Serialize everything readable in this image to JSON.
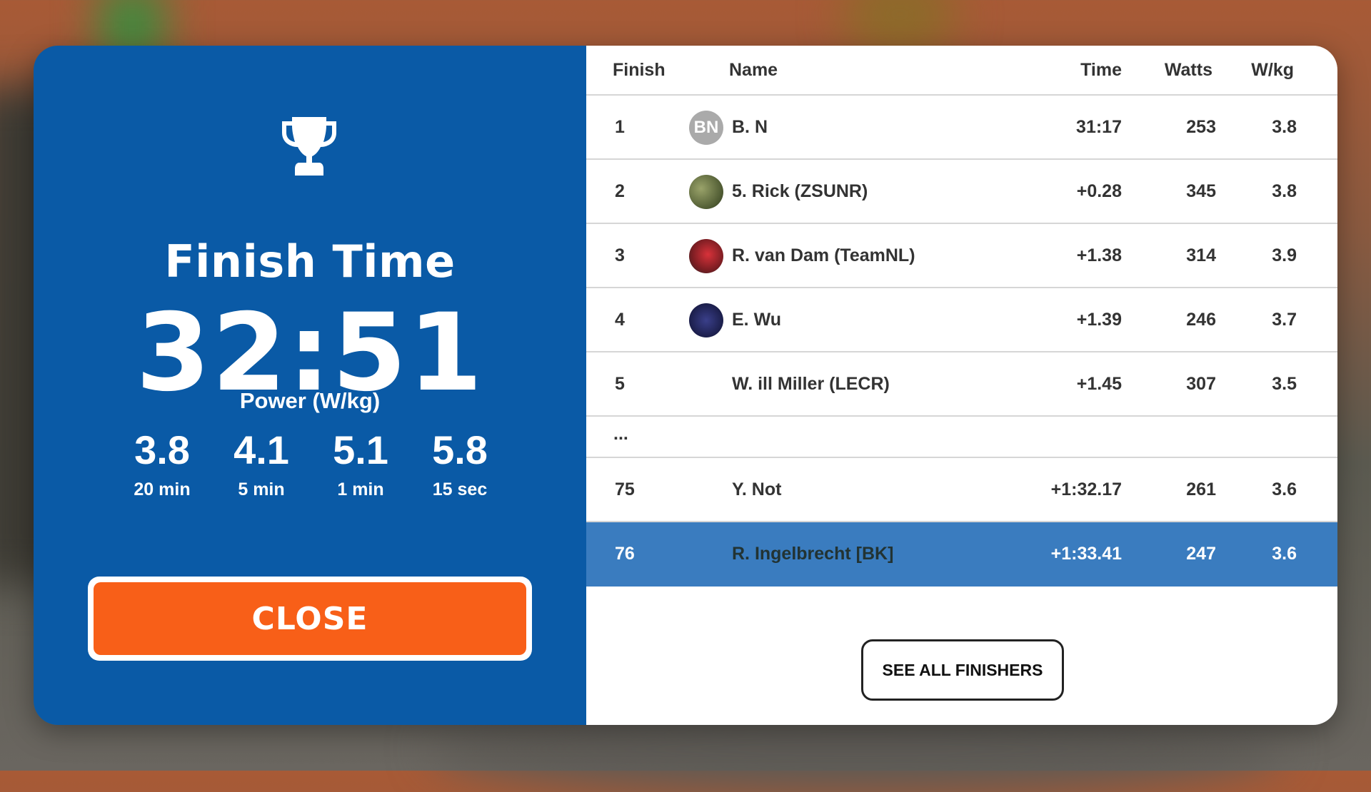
{
  "summary": {
    "title": "Finish Time",
    "finish_time": "32:51",
    "power_label": "Power (W/kg)",
    "power": [
      {
        "value": "3.8",
        "duration": "20 min"
      },
      {
        "value": "4.1",
        "duration": "5 min"
      },
      {
        "value": "5.1",
        "duration": "1 min"
      },
      {
        "value": "5.8",
        "duration": "15 sec"
      }
    ],
    "close_label": "CLOSE",
    "accent_color": "#0a5aa6",
    "close_color": "#f85f18"
  },
  "results": {
    "headers": {
      "finish": "Finish",
      "name": "Name",
      "time": "Time",
      "watts": "Watts",
      "wkg": "W/kg"
    },
    "rows": [
      {
        "pos": "1",
        "name": "B. N",
        "initials": "BN",
        "time": "31:17",
        "watts": "253",
        "wkg": "3.8"
      },
      {
        "pos": "2",
        "name": "5. Rick (ZSUNR)",
        "time": "+0.28",
        "watts": "345",
        "wkg": "3.8"
      },
      {
        "pos": "3",
        "name": "R. van Dam (TeamNL)",
        "time": "+1.38",
        "watts": "314",
        "wkg": "3.9"
      },
      {
        "pos": "4",
        "name": "E. Wu",
        "time": "+1.39",
        "watts": "246",
        "wkg": "3.7"
      },
      {
        "pos": "5",
        "name": "W. ill Miller (LECR)",
        "time": "+1.45",
        "watts": "307",
        "wkg": "3.5"
      }
    ],
    "ellipsis": "...",
    "tail_rows": [
      {
        "pos": "75",
        "name": "Y. Not",
        "time": "+1:32.17",
        "watts": "261",
        "wkg": "3.6"
      },
      {
        "pos": "76",
        "name": "R. Ingelbrecht [BK]",
        "time": "+1:33.41",
        "watts": "247",
        "wkg": "3.6"
      }
    ],
    "highlight_color": "#3a7cbf",
    "see_all_label": "SEE ALL FINISHERS"
  }
}
